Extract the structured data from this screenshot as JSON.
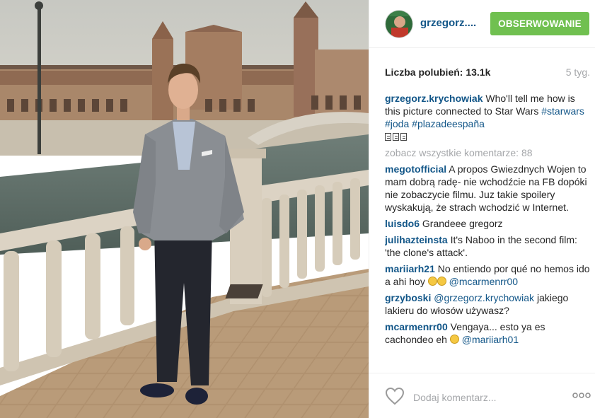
{
  "photo": {
    "alt_icon": "photo"
  },
  "header": {
    "username": "grzegorz....",
    "follow_label": "OBSERWOWANIE"
  },
  "stats": {
    "likes_label": "Liczba polubień:",
    "likes_count": "13.1k",
    "time_ago": "5 tyg."
  },
  "caption": {
    "user": "grzegorz.krychowiak",
    "text": "Who'll tell me how is this picture connected to Star Wars",
    "tags": [
      "#starwars",
      "#joda",
      "#plazadeespaña"
    ]
  },
  "view_all": "zobacz wszystkie komentarze: 88",
  "comments": [
    {
      "user": "megotofficial",
      "text": "A propos Gwiezdnych Wojen to mam dobrą radę- nie wchodźcie na FB dopóki nie zobaczycie filmu. Juz takie spoilery wyskakują, że strach wchodzić w Internet."
    },
    {
      "user": "luisdo6",
      "text": "Grandeee gregorz"
    },
    {
      "user": "julihazteinsta",
      "text": "It's Naboo in the second film: 'the clone's attack'."
    },
    {
      "user": "mariiarh21",
      "text": "No entiendo por qué no hemos ido a ahi hoy",
      "mention": "@mcarmenrr00"
    },
    {
      "user": "grzyboski",
      "mention": "@grzegorz.krychowiak",
      "text": "jakiego lakieru do włosów używasz?"
    },
    {
      "user": "mcarmenrr00",
      "text": "Vengaya... esto ya es cachondeo eh",
      "mention": "@mariiarh01"
    }
  ],
  "footer": {
    "comment_placeholder": "Dodaj komentarz..."
  },
  "colors": {
    "follow_green": "#70c050",
    "username_blue": "#125688",
    "muted_gray": "#a5a7aa"
  }
}
